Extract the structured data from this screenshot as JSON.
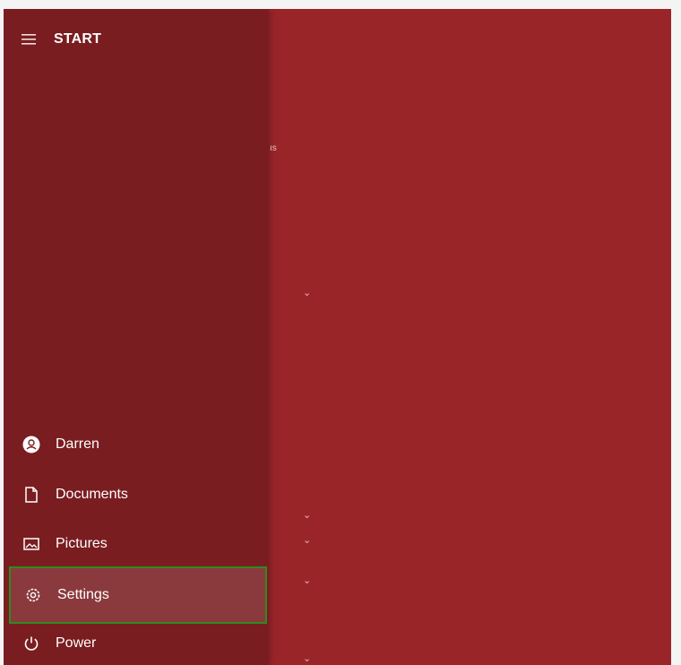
{
  "header": {
    "title": "START"
  },
  "nav": {
    "user": "Darren",
    "documents": "Documents",
    "pictures": "Pictures",
    "settings": "Settings",
    "power": "Power"
  },
  "icons": {
    "menu": "hamburger-icon",
    "user": "user-avatar-icon",
    "documents": "document-icon",
    "pictures": "pictures-icon",
    "settings": "gear-icon",
    "power": "power-icon",
    "expand": "chevron-down-icon"
  },
  "colors": {
    "nav_background": "#7a1d20",
    "content_background": "#9a2529",
    "selected_background": "#8a3a3d",
    "focus_outline": "#2e8b1e"
  },
  "selected_item": "Settings"
}
